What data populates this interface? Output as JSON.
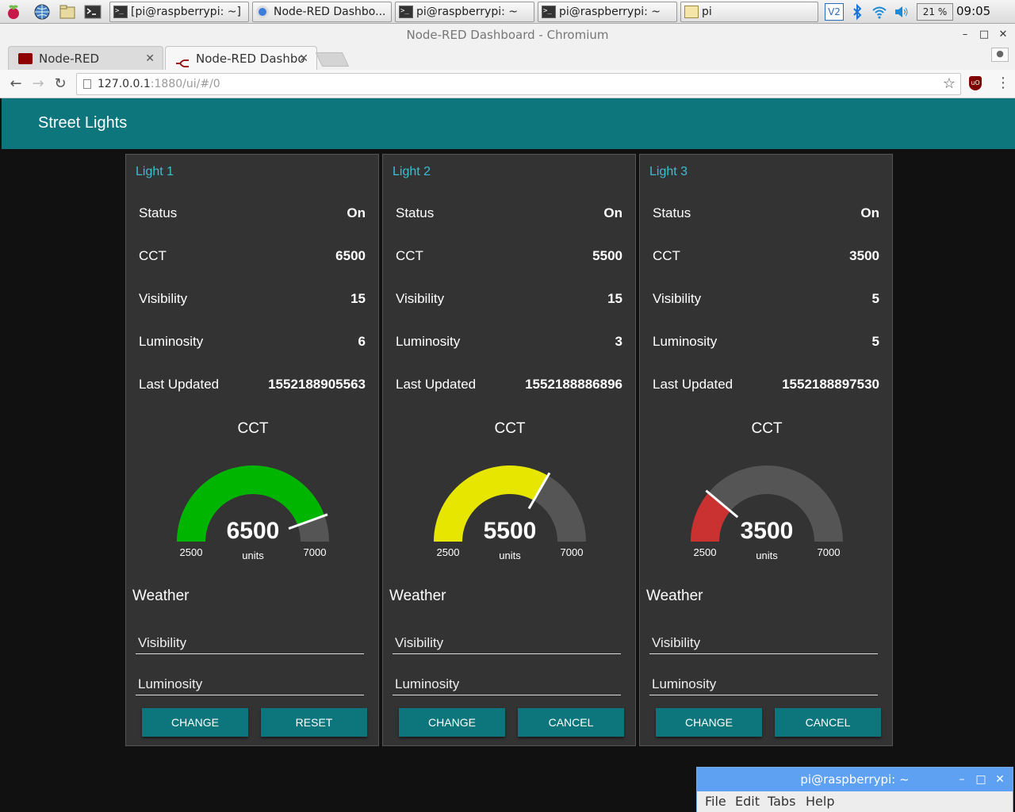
{
  "taskbar": {
    "buttons": [
      {
        "label": "[pi@raspberrypi: ~]",
        "icon": "terminal-icon"
      },
      {
        "label": "Node-RED Dashbo...",
        "icon": "chromium-icon"
      },
      {
        "label": "pi@raspberrypi: ~",
        "icon": "terminal-icon"
      },
      {
        "label": "pi@raspberrypi: ~",
        "icon": "terminal-icon"
      },
      {
        "label": "pi",
        "icon": "folder-icon"
      }
    ],
    "cpu": "21 %",
    "clock": "09:05"
  },
  "window": {
    "title": "Node-RED Dashboard - Chromium"
  },
  "tabs": [
    {
      "label": "Node-RED",
      "active": false
    },
    {
      "label": "Node-RED Dashbo",
      "active": true
    }
  ],
  "address": {
    "host": "127.0.0.1",
    "rest": ":1880/ui/#/0"
  },
  "dashboard": {
    "title": "Street Lights",
    "cards": [
      {
        "title": "Light 1",
        "rows": [
          {
            "label": "Status",
            "value": "On"
          },
          {
            "label": "CCT",
            "value": "6500"
          },
          {
            "label": "Visibility",
            "value": "15"
          },
          {
            "label": "Luminosity",
            "value": "6"
          },
          {
            "label": "Last Updated",
            "value": "1552188905563"
          }
        ],
        "gauge": {
          "title": "CCT",
          "value": 6500,
          "value_text": "6500",
          "units": "units",
          "min": 2500,
          "max": 7000,
          "min_text": "2500",
          "max_text": "7000",
          "color": "#00b500"
        },
        "weather": "Weather",
        "visibility_field": "Visibility",
        "luminosity_field": "Luminosity",
        "buttons": [
          "CHANGE",
          "RESET"
        ]
      },
      {
        "title": "Light 2",
        "rows": [
          {
            "label": "Status",
            "value": "On"
          },
          {
            "label": "CCT",
            "value": "5500"
          },
          {
            "label": "Visibility",
            "value": "15"
          },
          {
            "label": "Luminosity",
            "value": "3"
          },
          {
            "label": "Last Updated",
            "value": "1552188886896"
          }
        ],
        "gauge": {
          "title": "CCT",
          "value": 5500,
          "value_text": "5500",
          "units": "units",
          "min": 2500,
          "max": 7000,
          "min_text": "2500",
          "max_text": "7000",
          "color": "#e6e600"
        },
        "weather": "Weather",
        "visibility_field": "Visibility",
        "luminosity_field": "Luminosity",
        "buttons": [
          "CHANGE",
          "CANCEL"
        ]
      },
      {
        "title": "Light 3",
        "rows": [
          {
            "label": "Status",
            "value": "On"
          },
          {
            "label": "CCT",
            "value": "3500"
          },
          {
            "label": "Visibility",
            "value": "5"
          },
          {
            "label": "Luminosity",
            "value": "5"
          },
          {
            "label": "Last Updated",
            "value": "1552188897530"
          }
        ],
        "gauge": {
          "title": "CCT",
          "value": 3500,
          "value_text": "3500",
          "units": "units",
          "min": 2500,
          "max": 7000,
          "min_text": "2500",
          "max_text": "7000",
          "color": "#ca3232"
        },
        "weather": "Weather",
        "visibility_field": "Visibility",
        "luminosity_field": "Luminosity",
        "buttons": [
          "CHANGE",
          "CANCEL"
        ]
      }
    ]
  },
  "terminal": {
    "title": "pi@raspberrypi: ~",
    "menu": [
      "File",
      "Edit",
      "Tabs",
      "Help"
    ]
  }
}
